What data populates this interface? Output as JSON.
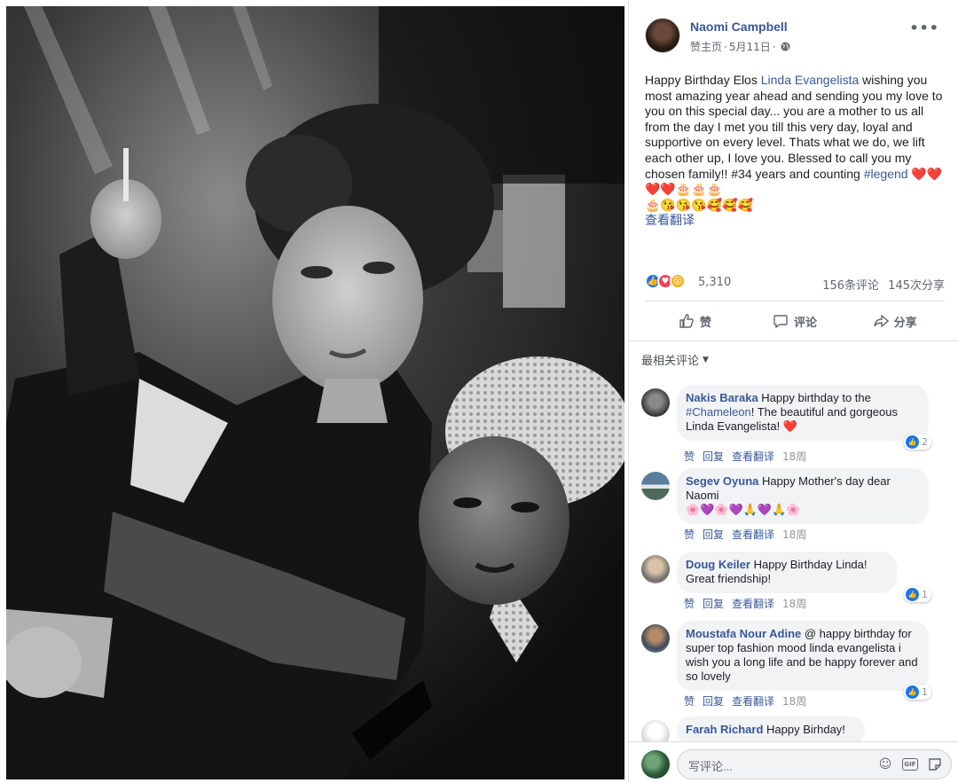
{
  "post": {
    "page_name": "Naomi Campbell",
    "page_type": "赞主页",
    "date": "5月11日",
    "more_label": "•••",
    "text_before_link": "Happy Birthday Elos ",
    "mention": "Linda Evangelista",
    "text_after_link": " wishing you most amazing year ahead and sending you my love to you on this special day... you are a mother to us all from the day I met you till this very day, loyal and supportive on every level. Thats what we do, we lift each other up, I love you. Blessed to call you my chosen family!! #34 years and counting ",
    "hashtag": "#legend",
    "emoji_line1": " ❤️❤️❤️❤️🎂🎂🎂",
    "emoji_line2": "🎂😘😘😘🥰🥰🥰",
    "see_translation": "查看翻译"
  },
  "reactions": {
    "count": "5,310",
    "comments": "156条评论",
    "shares": "145次分享"
  },
  "actions": {
    "like": "赞",
    "comment": "评论",
    "share": "分享"
  },
  "comment_sort": "最相关评论",
  "comment_action_labels": {
    "like": "赞",
    "reply": "回复",
    "translate": "查看翻译"
  },
  "comments": [
    {
      "author": "Nakis Baraka",
      "text_a": " Happy birthday to the ",
      "link": "#Chameleon",
      "text_b": "! The beautiful and gorgeous Linda Evangelista! ❤️",
      "time": "18周",
      "reactions": "2"
    },
    {
      "author": "Segev Oyuna",
      "text_a": " Happy Mother's day dear Naomi",
      "emojis": "🌸💜🌸💜🙏💜🙏🌸",
      "time": "18周"
    },
    {
      "author": "Doug Keiler",
      "text_a": " Happy Birthday Linda! Great friendship!",
      "time": "18周",
      "reactions": "1"
    },
    {
      "author": "Moustafa Nour Adine",
      "text_a": " @ happy birthday for super top fashion mood linda evangelista i wish you a long life and be happy forever and so lovely",
      "time": "18周",
      "reactions": "1"
    },
    {
      "author": "Farah Richard",
      "text_a": " Happy Birhday!"
    }
  ],
  "composer": {
    "placeholder": "写评论..."
  },
  "icons": {
    "globe": "globe-icon",
    "like": "thumbs-up-icon",
    "comment": "speech-bubble-icon",
    "share": "share-arrow-icon",
    "emoji": "smiley-icon",
    "gif": "gif-icon",
    "sticker": "sticker-icon"
  },
  "colors": {
    "link": "#385898",
    "meta": "#616770",
    "bubble": "#f2f3f5",
    "like_blue": "#1877f2",
    "love_red": "#f33e58"
  }
}
